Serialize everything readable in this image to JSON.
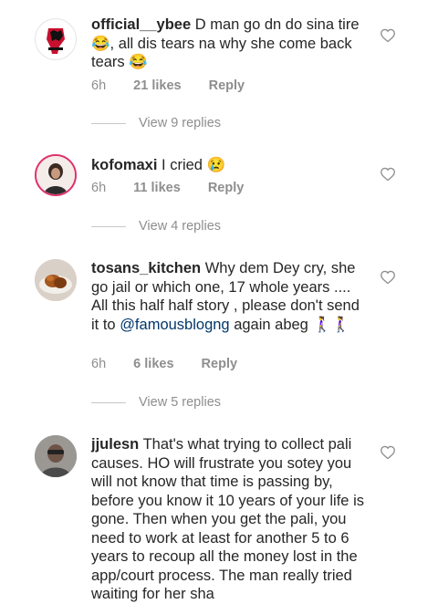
{
  "comments": [
    {
      "username": "official__ybee",
      "text": "D man go dn do sina tire 😂, all dis tears na why she come back tears 😂",
      "time": "6h",
      "likes": "21 likes",
      "reply": "Reply",
      "view_replies": "View 9 replies"
    },
    {
      "username": "kofomaxi",
      "text": "I cried 😢",
      "time": "6h",
      "likes": "11 likes",
      "reply": "Reply",
      "view_replies": "View 4 replies"
    },
    {
      "username": "tosans_kitchen",
      "text": "Why dem Dey cry, she go jail or which one, 17 whole years .... All this half half story , please don't send it to ",
      "mention": "@famousblogng",
      "text_after": " again abeg 🚶‍♀️🚶‍♀️",
      "time": "6h",
      "likes": "6 likes",
      "reply": "Reply",
      "view_replies": "View 5 replies"
    },
    {
      "username": "jjulesn",
      "text": "That's what trying to collect pali causes. HO will frustrate you sotey you will not know that time is passing by, before you know it 10 years of your life is gone. Then when you get the pali, you need to work at least for another 5 to 6 years to recoup all the money lost in the app/court process. The man really tried waiting for her sha"
    }
  ],
  "icons": {
    "like": "heart-outline-icon",
    "avatar_1": "raised-fist-logo-avatar",
    "avatar_2": "profile-photo-avatar",
    "avatar_3": "food-dish-avatar",
    "avatar_4": "profile-photo-avatar"
  },
  "colors": {
    "text": "#262626",
    "meta": "#8e8e8e",
    "mention": "#00376b",
    "story_ring": "#e1306c"
  }
}
